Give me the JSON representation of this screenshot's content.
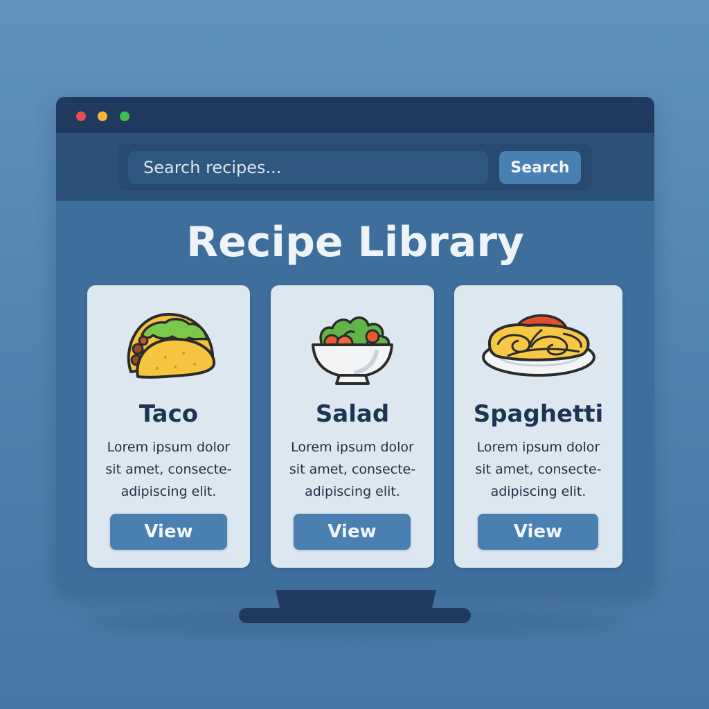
{
  "colors": {
    "background": "#5a8bb8",
    "titlebar": "#1f3a5e",
    "toolbar": "#2c5178",
    "content": "#3e6e9b",
    "card": "#dde7f0",
    "button": "#4a7fb1",
    "window_dot_red": "#e5504c",
    "window_dot_yellow": "#f2b838",
    "window_dot_green": "#3fbf4f"
  },
  "window": {
    "controls": [
      "close",
      "minimize",
      "maximize"
    ]
  },
  "search": {
    "placeholder": "Search recipes...",
    "value": "",
    "button_label": "Search"
  },
  "page": {
    "title": "Recipe Library"
  },
  "recipes": [
    {
      "name": "Taco",
      "icon": "taco-icon",
      "description": "Lorem ipsum dolor\nsit amet, consecte-\nadipiscing elit.",
      "button_label": "View"
    },
    {
      "name": "Salad",
      "icon": "salad-icon",
      "description": "Lorem ipsum dolor\nsit amet, consecte-\nadipiscing elit.",
      "button_label": "View"
    },
    {
      "name": "Spaghetti",
      "icon": "spaghetti-icon",
      "description": "Lorem ipsum dolor\nsit amet, consecte-\nadipiscing elit.",
      "button_label": "View"
    }
  ]
}
